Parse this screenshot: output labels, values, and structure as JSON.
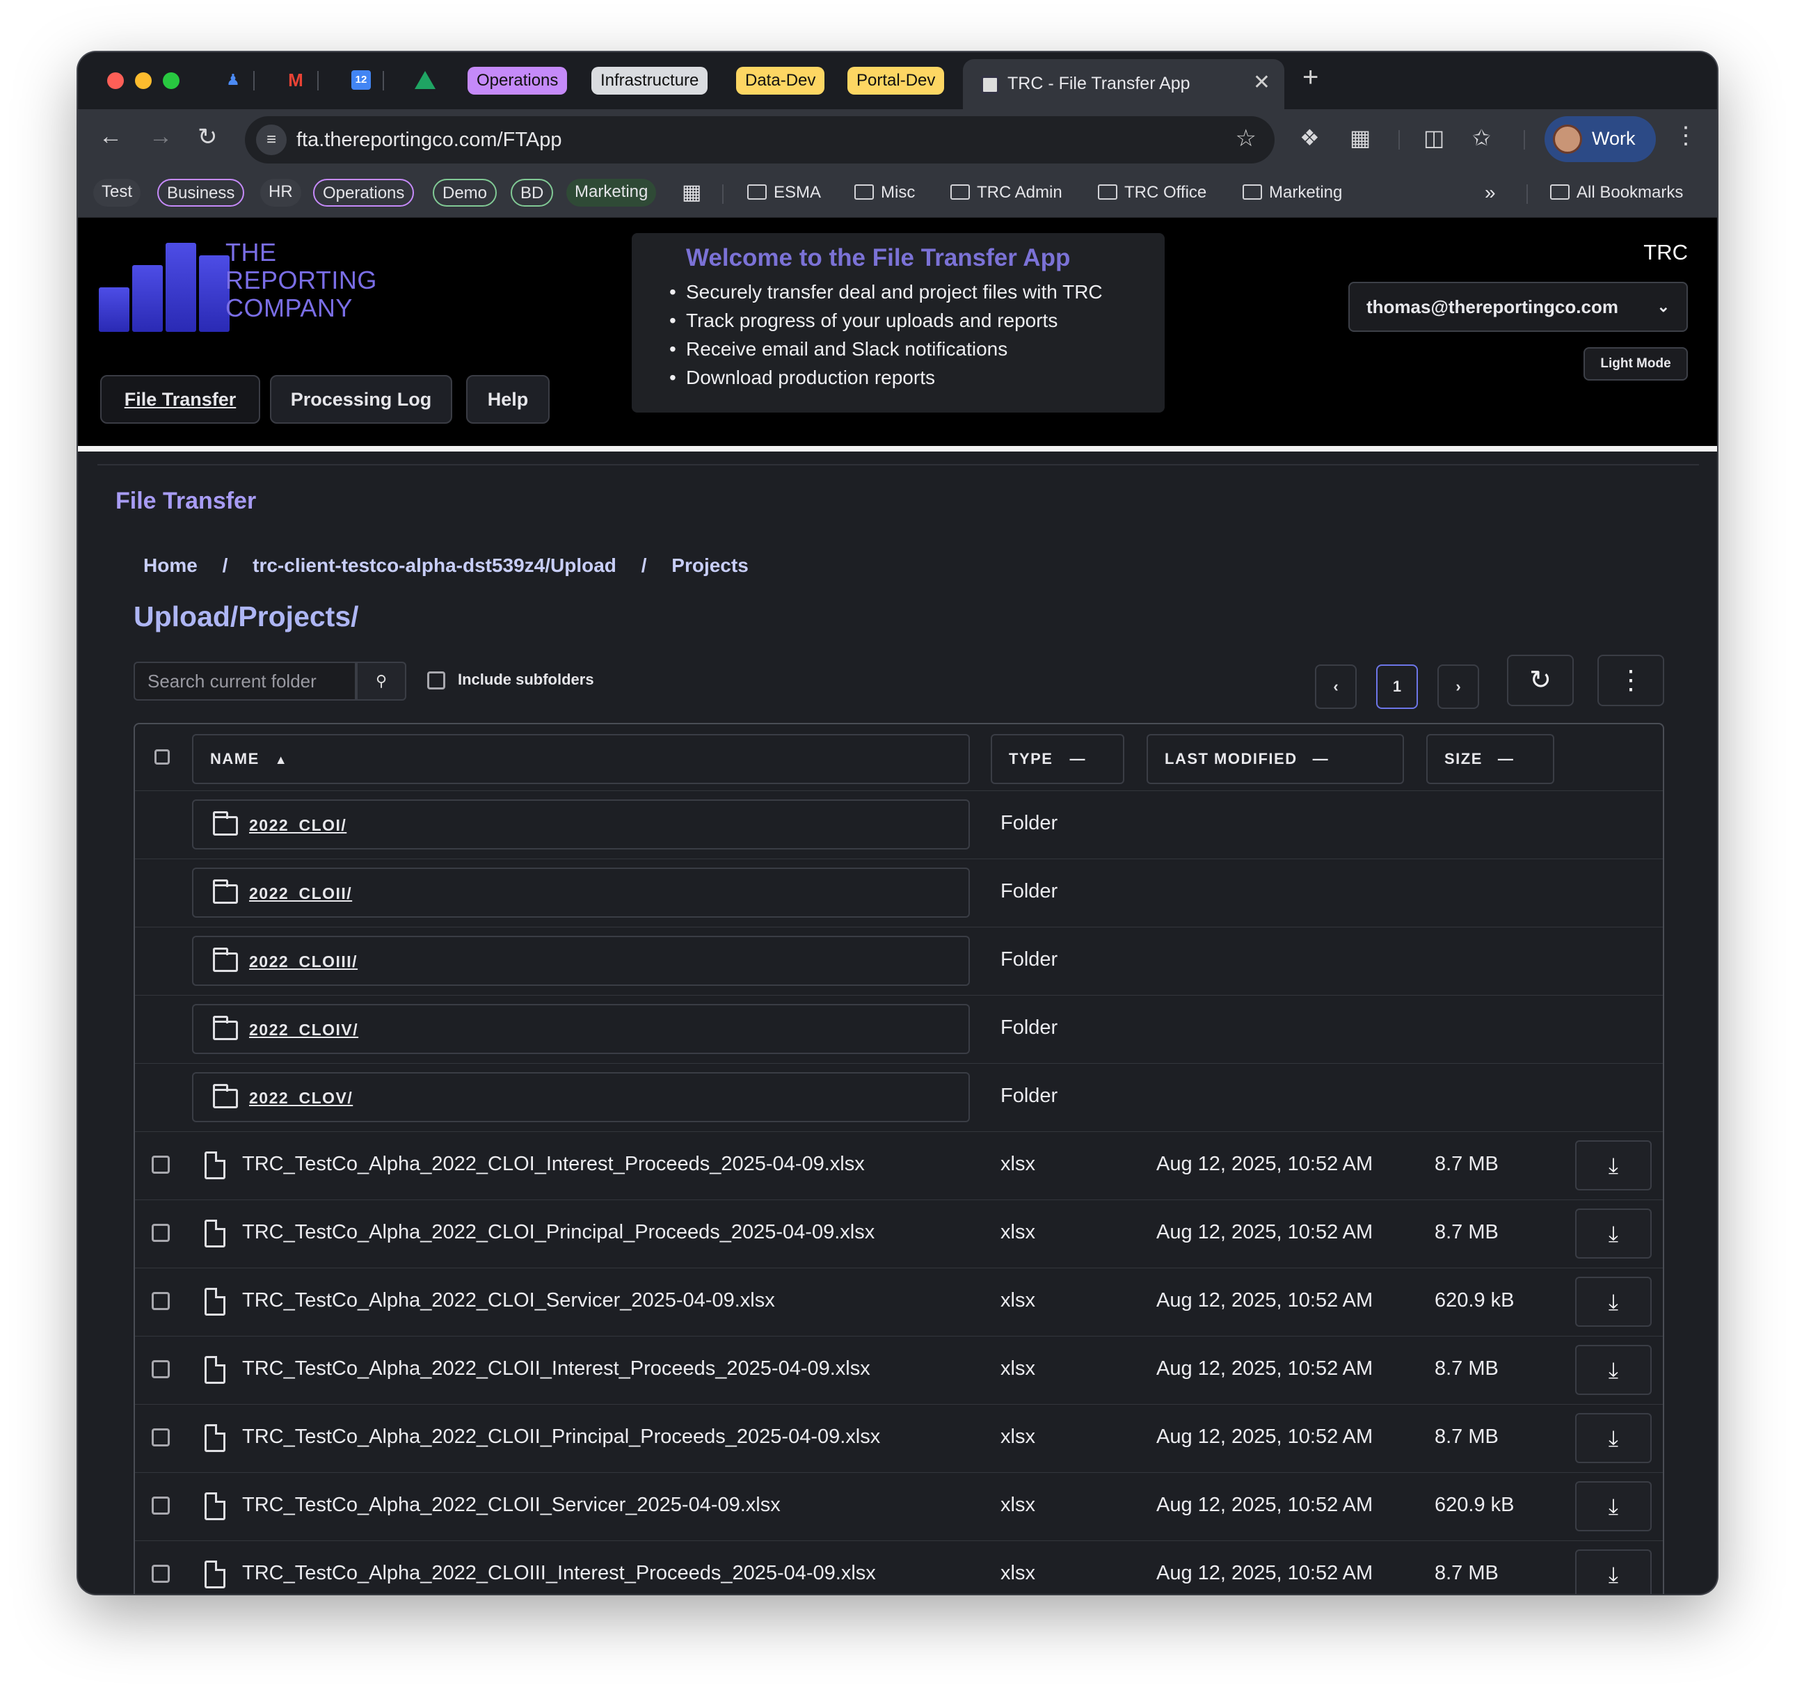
{
  "browser": {
    "tab_groups": [
      {
        "label": "Operations",
        "color": "#c58af9"
      },
      {
        "label": "Infrastructure",
        "color": "#dadce0"
      },
      {
        "label": "Data-Dev",
        "color": "#fdd663"
      },
      {
        "label": "Portal-Dev",
        "color": "#fdd663"
      }
    ],
    "active_tab_title": "TRC - File Transfer App",
    "url": "fta.thereportingco.com/FTApp",
    "profile_label": "Work",
    "bookmarks": [
      {
        "label": "Test"
      },
      {
        "label": "Business"
      },
      {
        "label": "HR"
      },
      {
        "label": "Operations"
      },
      {
        "label": "Demo"
      },
      {
        "label": "BD"
      },
      {
        "label": "Marketing"
      }
    ],
    "bookmark_folders": [
      "ESMA",
      "Misc",
      "TRC Admin",
      "TRC Office",
      "Marketing"
    ],
    "all_bookmarks": "All Bookmarks"
  },
  "app": {
    "logo_lines": [
      "THE",
      "REPORTING",
      "COMPANY"
    ],
    "nav": [
      "File Transfer",
      "Processing Log",
      "Help"
    ],
    "welcome_title": "Welcome to the File Transfer App",
    "welcome_items": [
      "Securely transfer deal and project files with TRC",
      "Track progress of your uploads and reports",
      "Receive email and Slack notifications",
      "Download production reports"
    ],
    "org": "TRC",
    "user_email": "thomas@thereportingco.com",
    "light_mode": "Light Mode"
  },
  "main": {
    "section_title": "File Transfer",
    "breadcrumb": [
      "Home",
      "/",
      "trc-client-testco-alpha-dst539z4/Upload",
      "/",
      "Projects"
    ],
    "path": "Upload/Projects/",
    "search_placeholder": "Search current folder",
    "include_subfolders": "Include subfolders",
    "page_prev": "‹",
    "page_current": "1",
    "page_next": "›",
    "columns": [
      "NAME",
      "TYPE",
      "LAST MODIFIED",
      "SIZE"
    ],
    "folders": [
      {
        "name": "2022_CLOI/",
        "type": "Folder"
      },
      {
        "name": "2022_CLOII/",
        "type": "Folder"
      },
      {
        "name": "2022_CLOIII/",
        "type": "Folder"
      },
      {
        "name": "2022_CLOIV/",
        "type": "Folder"
      },
      {
        "name": "2022_CLOV/",
        "type": "Folder"
      }
    ],
    "files": [
      {
        "name": "TRC_TestCo_Alpha_2022_CLOI_Interest_Proceeds_2025-04-09.xlsx",
        "type": "xlsx",
        "modified": "Aug 12, 2025, 10:52 AM",
        "size": "8.7 MB"
      },
      {
        "name": "TRC_TestCo_Alpha_2022_CLOI_Principal_Proceeds_2025-04-09.xlsx",
        "type": "xlsx",
        "modified": "Aug 12, 2025, 10:52 AM",
        "size": "8.7 MB"
      },
      {
        "name": "TRC_TestCo_Alpha_2022_CLOI_Servicer_2025-04-09.xlsx",
        "type": "xlsx",
        "modified": "Aug 12, 2025, 10:52 AM",
        "size": "620.9 kB"
      },
      {
        "name": "TRC_TestCo_Alpha_2022_CLOII_Interest_Proceeds_2025-04-09.xlsx",
        "type": "xlsx",
        "modified": "Aug 12, 2025, 10:52 AM",
        "size": "8.7 MB"
      },
      {
        "name": "TRC_TestCo_Alpha_2022_CLOII_Principal_Proceeds_2025-04-09.xlsx",
        "type": "xlsx",
        "modified": "Aug 12, 2025, 10:52 AM",
        "size": "8.7 MB"
      },
      {
        "name": "TRC_TestCo_Alpha_2022_CLOII_Servicer_2025-04-09.xlsx",
        "type": "xlsx",
        "modified": "Aug 12, 2025, 10:52 AM",
        "size": "620.9 kB"
      },
      {
        "name": "TRC_TestCo_Alpha_2022_CLOIII_Interest_Proceeds_2025-04-09.xlsx",
        "type": "xlsx",
        "modified": "Aug 12, 2025, 10:52 AM",
        "size": "8.7 MB"
      }
    ]
  }
}
